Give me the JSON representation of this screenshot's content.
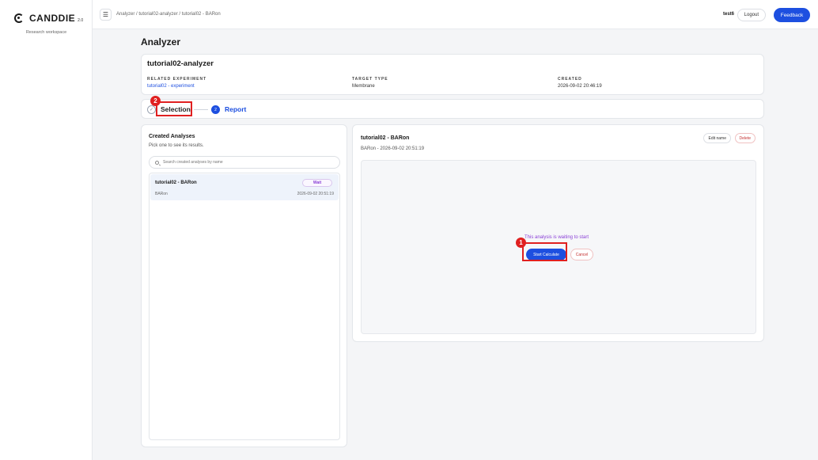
{
  "app": {
    "logo": "CANDDIE",
    "version": "2.0",
    "workspace": "Research workspace"
  },
  "topbar": {
    "breadcrumb": "Analyzer / tutorial02-analyzer / tutorial02 - BARon",
    "user": "test6",
    "logout_label": "Logout",
    "feedback_label": "Feedback"
  },
  "page": {
    "title": "Analyzer"
  },
  "analyzer": {
    "name": "tutorial02-analyzer",
    "related_experiment_label": "RELATED EXPERIMENT",
    "related_experiment_value": "tutorial02 - experiment",
    "target_type_label": "TARGET TYPE",
    "target_type_value": "Membrane",
    "created_label": "CREATED",
    "created_value": "2026-09-02 20:46:19"
  },
  "steps": [
    {
      "number": "1",
      "label": "Selection",
      "icon": "check-icon",
      "state": "done"
    },
    {
      "number": "2",
      "label": "Report",
      "state": "active"
    }
  ],
  "annotations": [
    {
      "number": "1",
      "target": "start-calculate-button"
    },
    {
      "number": "2",
      "target": "step-selection"
    }
  ],
  "created_analyses": {
    "title": "Created Analyses",
    "subtitle": "Pick one to see its results.",
    "search_placeholder": "Search created analyses by name",
    "items": [
      {
        "name": "tutorial02 - BARon",
        "type": "BARon",
        "status": "Wait",
        "date": "2026-09-02 20:51:19"
      }
    ]
  },
  "detail": {
    "title": "tutorial02 - BARon",
    "subtitle": "BARon - 2026-09-02 20:51:19",
    "edit_label": "Edit name",
    "delete_label": "Delete",
    "waiting_text": "This analysis is waiting to start",
    "start_label": "Start Calculate",
    "cancel_label": "Cancel"
  },
  "colors": {
    "primary": "#1d4fe0",
    "annotation": "#e02020",
    "status_wait": "#8a3fd6",
    "danger": "#c43030"
  }
}
